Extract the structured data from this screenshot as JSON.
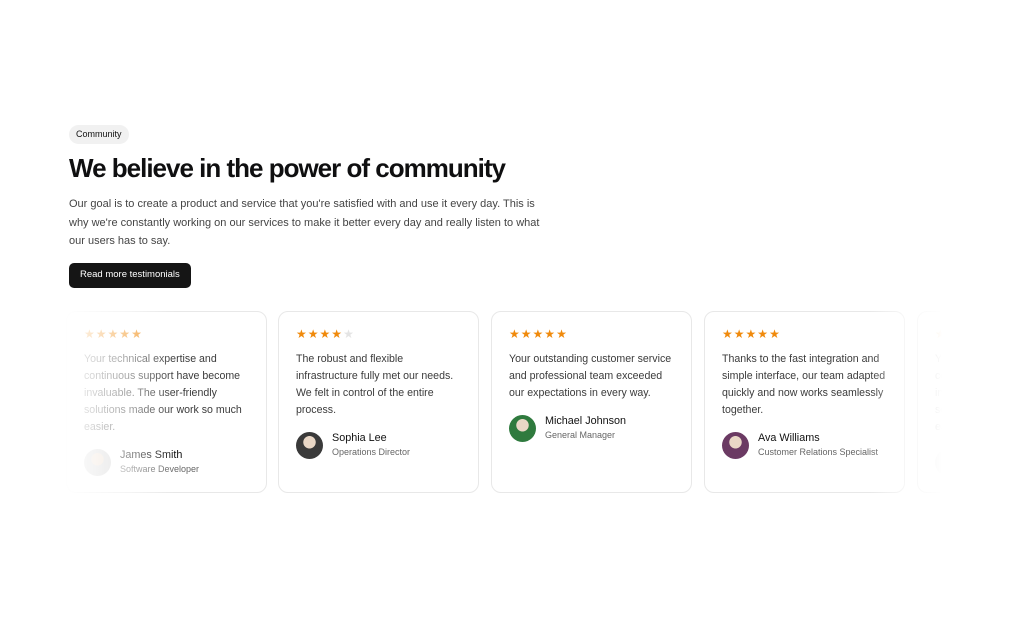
{
  "hero": {
    "badge": "Community",
    "title": "We believe in the power of community",
    "subtitle": "Our goal is to create a product and service that you're satisfied with and use it every day. This is why we're constantly working on our services to make it better every day and really listen to what our users has to say.",
    "cta": "Read more testimonials"
  },
  "testimonials": [
    {
      "rating": 5,
      "quote": "Your technical expertise and continuous support have become invaluable. The user-friendly solutions made our work so much easier.",
      "name": "James Smith",
      "role": "Software Developer",
      "avatar_color": "#cfcfcf"
    },
    {
      "rating": 4,
      "quote": "The robust and flexible infrastructure fully met our needs. We felt in control of the entire process.",
      "name": "Sophia Lee",
      "role": "Operations Director",
      "avatar_color": "#3a3a3a"
    },
    {
      "rating": 5,
      "quote": "Your outstanding customer service and professional team exceeded our expectations in every way.",
      "name": "Michael Johnson",
      "role": "General Manager",
      "avatar_color": "#2f7a3e"
    },
    {
      "rating": 5,
      "quote": "Thanks to the fast integration and simple interface, our team adapted quickly and now works seamlessly together.",
      "name": "Ava Williams",
      "role": "Customer Relations Specialist",
      "avatar_color": "#6b3a63"
    }
  ],
  "colors": {
    "star_on": "#f08a0c",
    "star_off": "#e4e4e4",
    "button_bg": "#151515"
  }
}
